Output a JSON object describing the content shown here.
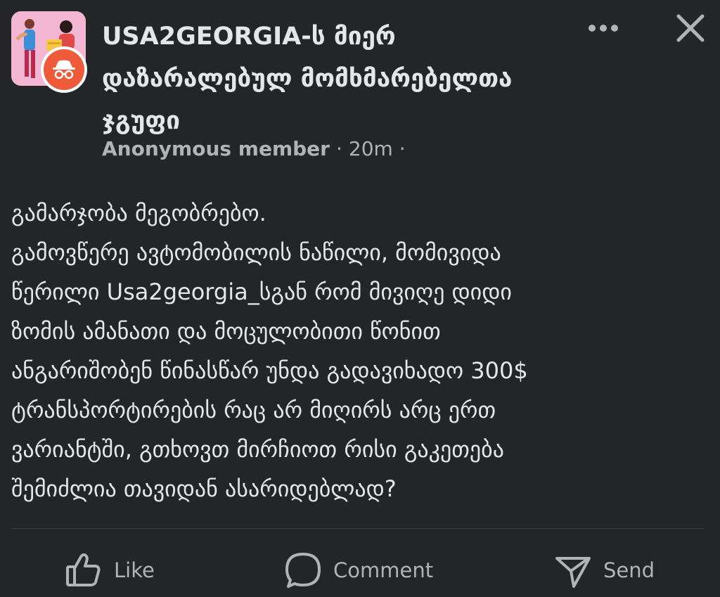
{
  "header": {
    "group_name": "USA2GEORGIA-ს მიერ დაზარალებულ მომხმარებელთა ჯგუფი",
    "author": "Anonymous member",
    "separator": "·",
    "timestamp": "20m",
    "trailing_separator": "·"
  },
  "post": {
    "lines": [
      "გამარჯობა მეგობრებო.",
      "გამოვწერე ავტომობილის ნაწილი, მომივიდა",
      "წერილი Usa2georgia_სგან რომ მივიღე დიდი",
      "ზომის ამანათი და მოცულობითი წონით",
      "ანგარიშობენ  წინასწარ უნდა გადავიხადო 300$",
      "ტრანსპორტირების რაც არ მიღირს არც ერთ",
      "ვარიანტში, გთხოვთ მირჩიოთ რისი გაკეთება",
      "შემიძლია თავიდან ასარიდებლად?"
    ]
  },
  "actions": {
    "like": "Like",
    "comment": "Comment",
    "send": "Send"
  },
  "icons": {
    "more": "more-dots-icon",
    "close": "close-icon",
    "like": "thumbs-up-icon",
    "comment": "comment-bubble-icon",
    "send": "send-arrow-icon",
    "anonymous": "anonymous-incognito-icon"
  },
  "colors": {
    "background": "#242526",
    "primary_text": "#e4e6eb",
    "secondary_text": "#b0b3b8",
    "divider": "#3e4042",
    "avatar_bg": "#f3b6d3",
    "anon_badge": "#ee5a3a"
  }
}
